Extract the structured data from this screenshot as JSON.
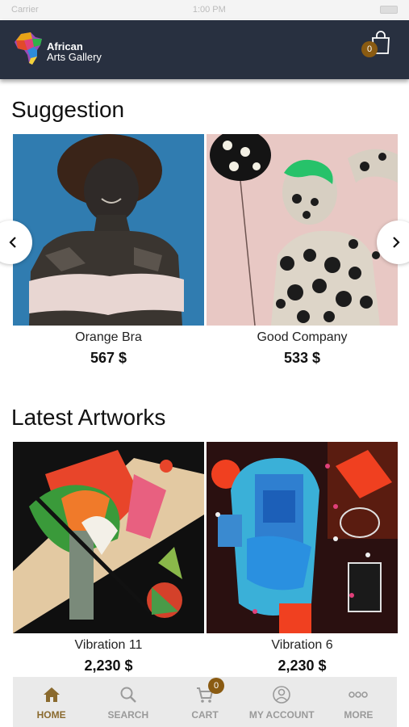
{
  "status_bar": {
    "carrier": "Carrier",
    "time": "1:00 PM"
  },
  "header": {
    "brand_line1": "African",
    "brand_line2": "Arts Gallery",
    "cart_count": "0",
    "colors": {
      "background": "#283040",
      "badge": "#8a5b12"
    }
  },
  "suggestion": {
    "title": "Suggestion",
    "items": [
      {
        "name": "Orange Bra",
        "price": "567 $"
      },
      {
        "name": "Good Company",
        "price": "533 $"
      }
    ],
    "prev_icon": "chevron-left-icon",
    "next_icon": "chevron-right-icon"
  },
  "latest": {
    "title": "Latest Artworks",
    "items": [
      {
        "name": "Vibration 11",
        "price": "2,230 $"
      },
      {
        "name": "Vibration 6",
        "price": "2,230 $"
      }
    ]
  },
  "tabbar": {
    "tabs": [
      {
        "label": "HOME",
        "icon": "home-icon",
        "active": true
      },
      {
        "label": "SEARCH",
        "icon": "search-icon",
        "active": false
      },
      {
        "label": "CART",
        "icon": "cart-icon",
        "active": false
      },
      {
        "label": "MY ACCOUNT",
        "icon": "account-icon",
        "active": false
      },
      {
        "label": "MORE",
        "icon": "more-icon",
        "active": false
      }
    ],
    "cart_badge": "0"
  }
}
